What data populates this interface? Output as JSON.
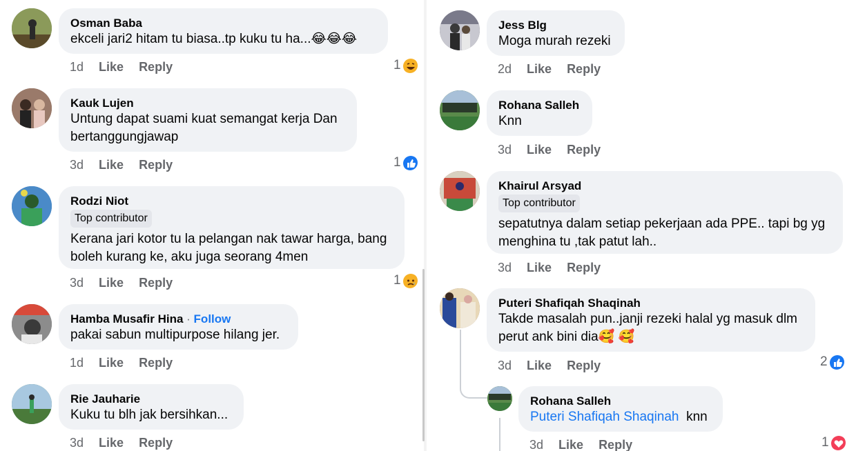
{
  "left_comments": [
    {
      "name": "Osman Baba",
      "text": [
        "ekceli jari2 hitam tu biasa..tp kuku tu ha..."
      ],
      "emojis": "😂😂😂",
      "time": "1d",
      "like": "Like",
      "reply": "Reply",
      "reaction_count": "1",
      "reaction_type": "haha",
      "avatar_color": "#6b7a4a"
    },
    {
      "name": "Kauk Lujen",
      "text": [
        "Untung dapat suami kuat semangat kerja Dan",
        "bertanggungjawap"
      ],
      "time": "3d",
      "like": "Like",
      "reply": "Reply",
      "reaction_count": "1",
      "reaction_type": "like",
      "avatar_color": "#7a5a4e"
    },
    {
      "name": "Rodzi Niot",
      "badge": "Top contributor",
      "text": [
        "Kerana jari kotor tu la pelangan nak tawar harga, bang",
        "boleh kurang ke, aku juga seorang 4men"
      ],
      "time": "3d",
      "like": "Like",
      "reply": "Reply",
      "reaction_count": "1",
      "reaction_type": "sad",
      "avatar_color": "#3a78b8"
    },
    {
      "name": "Hamba Musafir Hina",
      "follow": "Follow",
      "text": [
        "pakai sabun multipurpose hilang jer."
      ],
      "time": "1d",
      "like": "Like",
      "reply": "Reply",
      "avatar_color": "#6c6c6c"
    },
    {
      "name": "Rie Jauharie",
      "text": [
        "Kuku tu blh jak bersihkan..."
      ],
      "time": "3d",
      "like": "Like",
      "reply": "Reply",
      "avatar_color": "#4e7f5a"
    }
  ],
  "right_comments": [
    {
      "name": "Jess Blg",
      "text": [
        "Moga murah rezeki"
      ],
      "time": "2d",
      "like": "Like",
      "reply": "Reply",
      "avatar_color": "#5a5a66"
    },
    {
      "name": "Rohana Salleh",
      "text": [
        "Knn"
      ],
      "time": "3d",
      "like": "Like",
      "reply": "Reply",
      "avatar_color": "#2f5a3a",
      "avatar_text": "Jerai Hil"
    },
    {
      "name": "Khairul Arsyad",
      "badge": "Top contributor",
      "text": [
        "sepatutnya dalam setiap pekerjaan ada PPE.. tapi bg yg",
        "menghina tu ,tak patut lah.."
      ],
      "time": "3d",
      "like": "Like",
      "reply": "Reply",
      "avatar_color": "#b8423a"
    },
    {
      "name": "Puteri Shafiqah Shaqinah",
      "text": [
        "Takde masalah pun..janji rezeki halal yg masuk dlm",
        "perut ank bini dia"
      ],
      "emojis": "🥰 🥰",
      "time": "3d",
      "like": "Like",
      "reply": "Reply",
      "reaction_count": "2",
      "reaction_type": "like",
      "avatar_color": "#8a6a4e"
    }
  ],
  "reply_comment": {
    "name": "Rohana Salleh",
    "mention": "Puteri Shafiqah Shaqinah",
    "text": "knn",
    "time": "3d",
    "like": "Like",
    "reply": "Reply",
    "reaction_count": "1",
    "reaction_type": "love",
    "avatar_color": "#2f5a3a",
    "avatar_text": "Jerai Hil"
  },
  "colors": {
    "bubble": "#f0f2f5",
    "link": "#1877f2",
    "meta": "#65676b",
    "like_blue": "#1877f2",
    "love_red": "#f33e58",
    "haha_yellow": "#f7b125"
  }
}
